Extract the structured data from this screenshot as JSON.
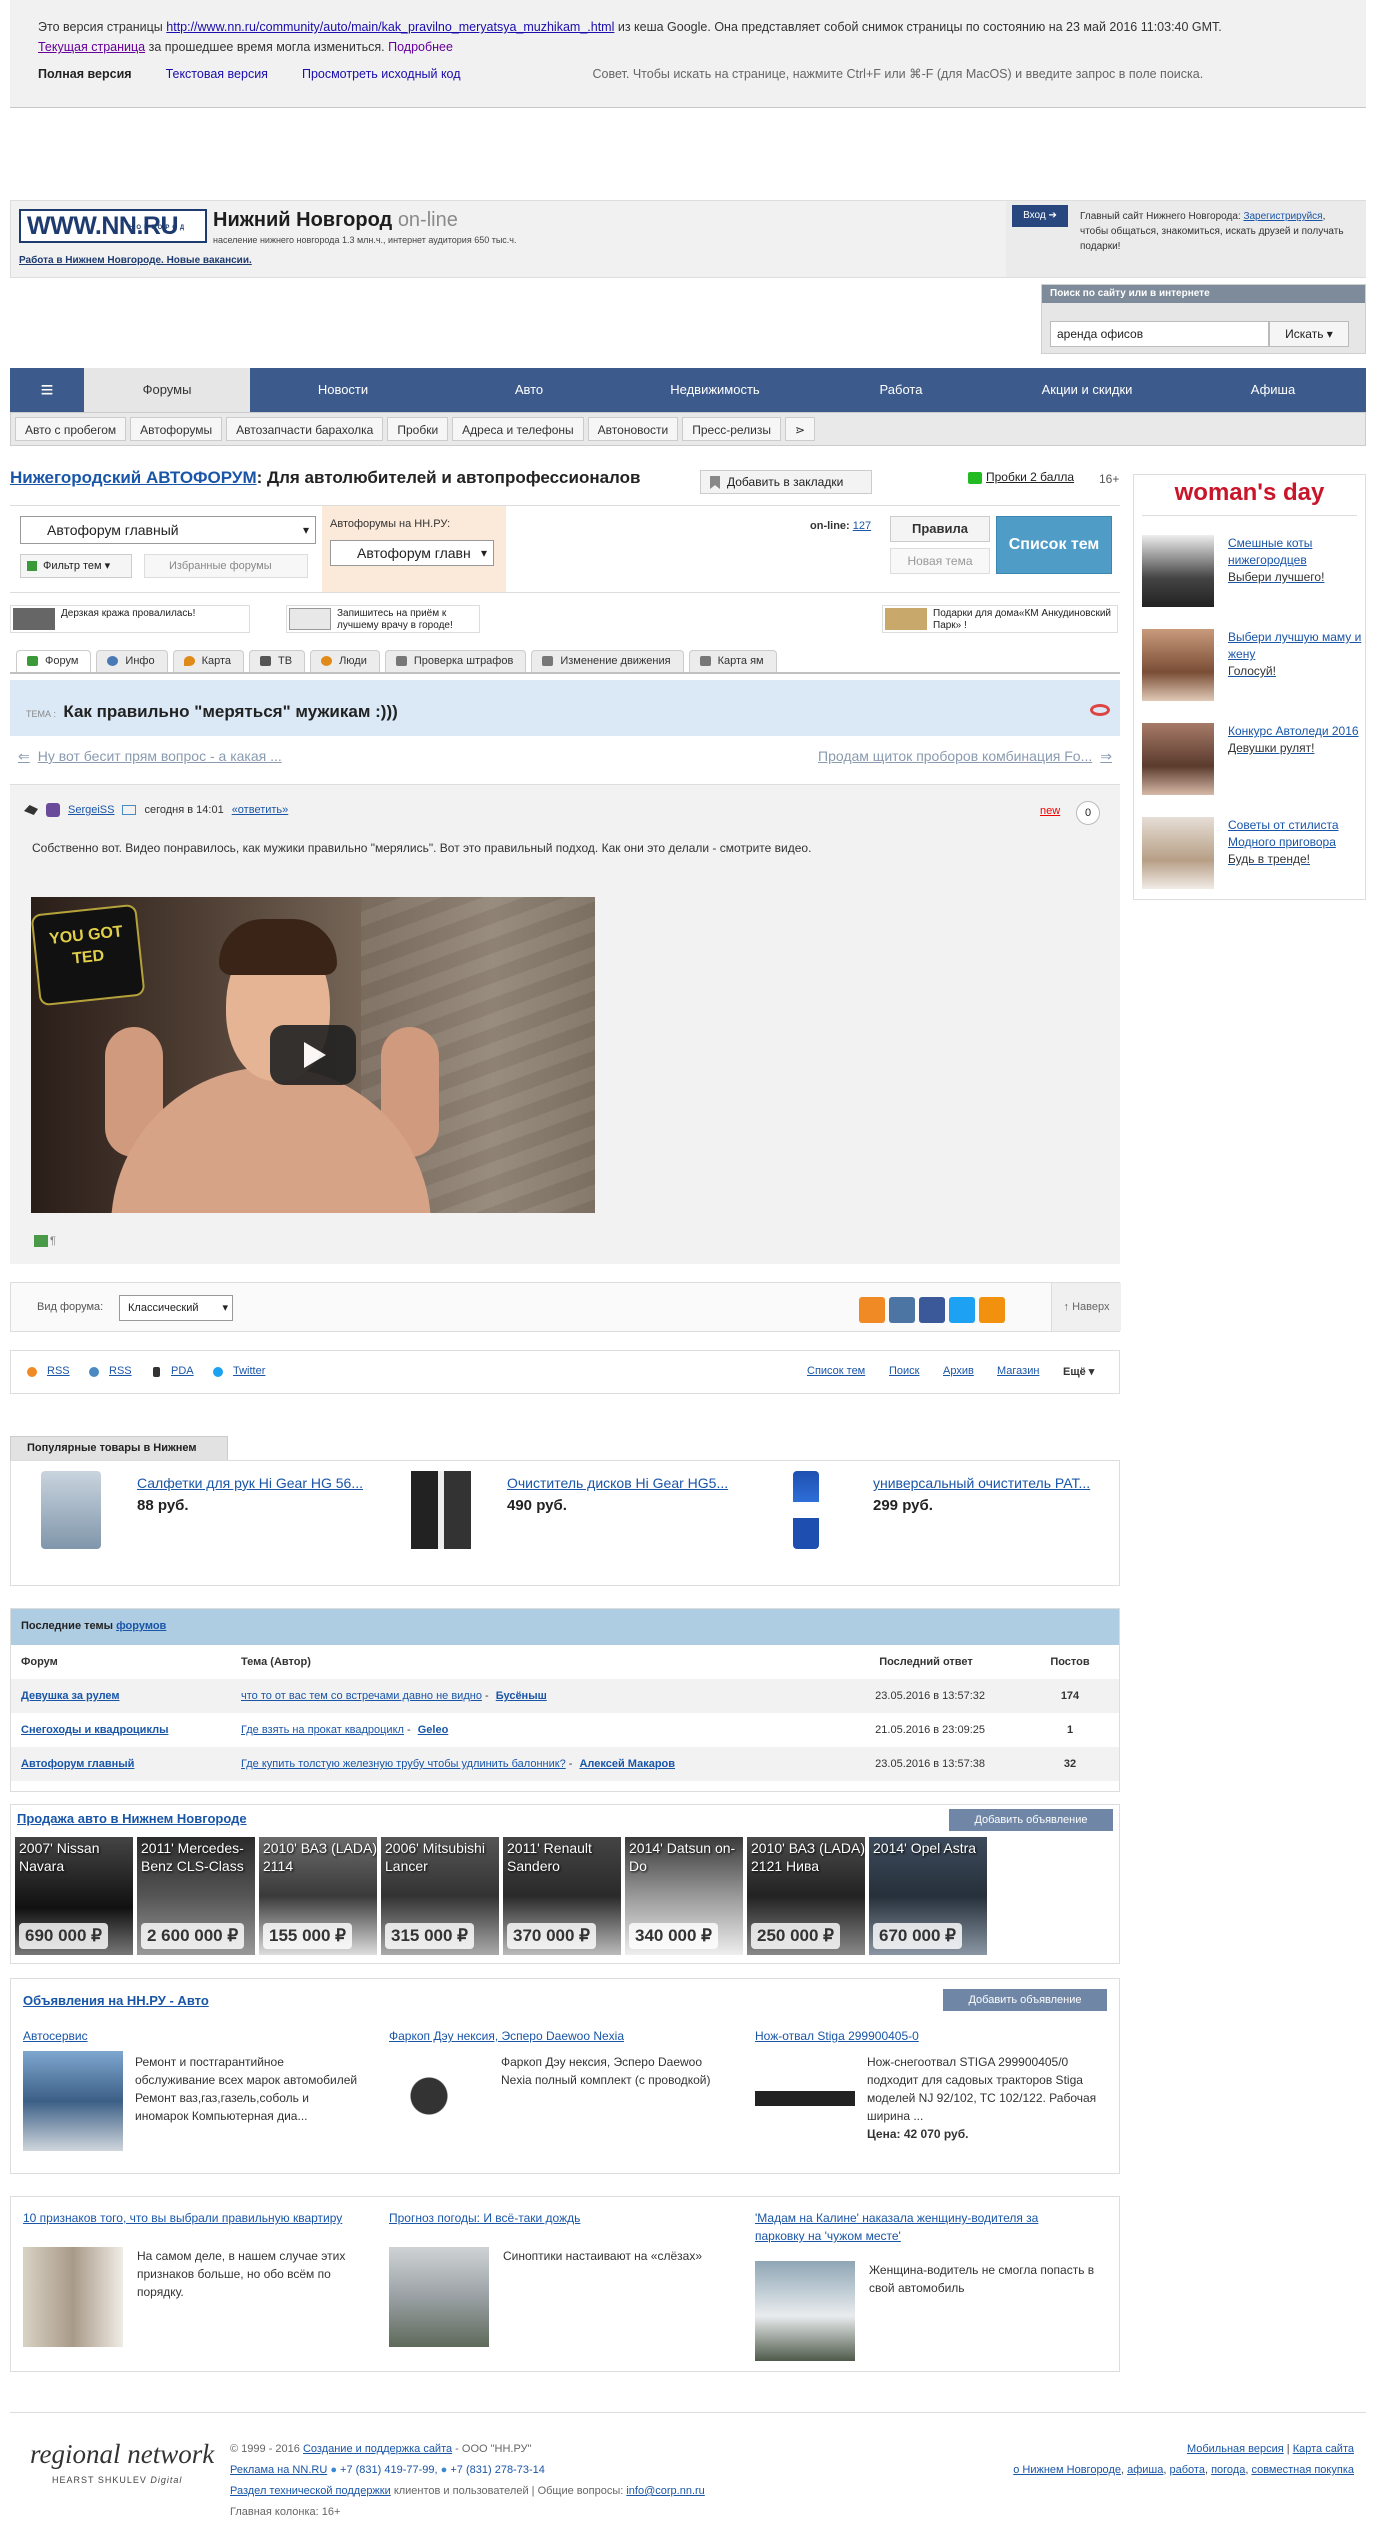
{
  "cache": {
    "line1_prefix": "Это версия страницы",
    "url": "http://www.nn.ru/community/auto/main/kak_pravilno_meryatsya_muzhikam_.html",
    "line1_suffix": "из кеша Google. Она представляет собой снимок страницы по состоянию на 23 май 2016 11:03:40 GMT.",
    "current_link": "Текущая страница",
    "line2_mid": "за прошедшее время могла измениться.",
    "more_link": "Подробнее",
    "full_version": "Полная версия",
    "text_version": "Текстовая версия",
    "source_link": "Просмотреть исходный код",
    "tip": "Совет. Чтобы искать на странице, нажмите Ctrl+F или ⌘-F (для MacOS) и введите запрос в поле поиска."
  },
  "header": {
    "logo": "WWW.NN.RU",
    "logo_sub": "НОВГОРОД",
    "city": "Нижний Новгород",
    "online": "on-line",
    "population": "население нижнего новгорода 1.3 млн.ч., интернет аудитория 650 тыс.ч.",
    "jobs_link": "Работа в Нижнем Новгороде. Новые вакансии.",
    "login": "Вход ➔",
    "login_text_1": "Главный сайт Нижнего Новгорода:",
    "register": "Зарегистрируйся",
    "login_text_2": ", чтобы общаться, знакомиться, искать друзей и получать подарки!"
  },
  "search": {
    "title": "Поиск по сайту или в интернете",
    "value": "аренда офисов",
    "button": "Искать ▾"
  },
  "nav": {
    "menu_icon": "≡",
    "items": [
      "Форумы",
      "Новости",
      "Авто",
      "Недвижимость",
      "Работа",
      "Акции и скидки",
      "Афиша"
    ]
  },
  "subnav": {
    "items": [
      "Авто с пробегом",
      "Автофорумы",
      "Автозапчасти барахолка",
      "Пробки",
      "Адреса и телефоны",
      "Автоновости",
      "Пресс-релизы",
      "⋗"
    ]
  },
  "forum": {
    "title_link": "Нижегородский АВТОФОРУМ",
    "title_rest": ": Для автолюбителей и автопрофессионалов",
    "bookmark": "Добавить в закладки",
    "probki": "Пробки 2 балла",
    "age": "16+",
    "select": "Автофорум главный",
    "filter": "Фильтр тем ▾",
    "favorites": "Избранные форумы",
    "nn_forums_label": "Автофорумы на НН.РУ:",
    "nn_forums_select": "Автофорум главн",
    "online_label": "on-line:",
    "online_count": "127",
    "rules": "Правила",
    "new_topic": "Новая тема",
    "topics_list": "Список тем"
  },
  "promos": [
    "Дерзкая кража провалилась!",
    "Запишитесь на приём к лучшему врачу в городе!",
    "Подарки для дома«КМ Анкудиновский Парк» !"
  ],
  "tabs": [
    "Форум",
    "Инфо",
    "Карта",
    "ТВ",
    "Люди",
    "Проверка штрафов",
    "Изменение движения",
    "Карта ям"
  ],
  "topic": {
    "label": "ТЕМА :",
    "title": "Как правильно \"меряться\" мужикам :)))",
    "prev": "Ну вот бесит прям вопрос - а какая ...",
    "next": "Продам щиток проборов комбинация Fo...",
    "prev_arrow": "⇐",
    "next_arrow": "⇒"
  },
  "post": {
    "author": "SergeiSS",
    "date": "сегодня в 14:01",
    "reply": "«ответить»",
    "new": "new",
    "rating": "0",
    "text": "Собственно вот. Видео понравилось, как мужики правильно \"мерялись\". Вот это правильный подход. Как они это делали - смотрите видео.",
    "video_logo": "YOU GOT TED",
    "pilcrow": "¶"
  },
  "view": {
    "label": "Вид форума:",
    "select": "Классический",
    "totop": "↑ Наверх"
  },
  "links": {
    "left": [
      "RSS",
      "RSS",
      "PDA",
      "Twitter"
    ],
    "right": [
      "Список тем",
      "Поиск",
      "Архив",
      "Магазин"
    ],
    "more": "Ещё ▾"
  },
  "popular": {
    "tab": "Популярные товары в Нижнем",
    "items": [
      {
        "name": "Салфетки для рук Hi Gear HG 56...",
        "price": "88 руб."
      },
      {
        "name": "Очиститель дисков Hi Gear HG5...",
        "price": "490 руб."
      },
      {
        "name": "универсальный очиститель PAT...",
        "price": "299 руб."
      }
    ]
  },
  "last_topics": {
    "title_prefix": "Последние темы",
    "title_link": "форумов",
    "columns": [
      "Форум",
      "Тема (Автор)",
      "Последний ответ",
      "Постов"
    ],
    "rows": [
      {
        "forum": "Девушка за рулем",
        "topic": "что то от вас тем со встречами давно не видно",
        "author": "Бусёныш",
        "last": "23.05.2016 в 13:57:32",
        "posts": "174"
      },
      {
        "forum": "Снегоходы и квадроциклы",
        "topic": "Где взять на прокат квадроцикл",
        "author": "Geleo",
        "last": "21.05.2016 в 23:09:25",
        "posts": "1"
      },
      {
        "forum": "Автофорум главный",
        "topic": "Где купить толстую железную трубу чтобы удлинить балонник?",
        "author": "Алексей Макаров",
        "last": "23.05.2016 в 13:57:38",
        "posts": "32"
      }
    ]
  },
  "autosale": {
    "title": "Продажа авто в Нижнем Новгороде",
    "add": "Добавить объявление",
    "cars": [
      {
        "name": "2007' Nissan Navara",
        "price": "690 000 ₽"
      },
      {
        "name": "2011' Mercedes-Benz CLS-Class",
        "price": "2 600 000 ₽"
      },
      {
        "name": "2010' ВАЗ (LADA) 2114",
        "price": "155 000 ₽"
      },
      {
        "name": "2006' Mitsubishi Lancer",
        "price": "315 000 ₽"
      },
      {
        "name": "2011' Renault Sandero",
        "price": "370 000 ₽"
      },
      {
        "name": "2014' Datsun on-Do",
        "price": "340 000 ₽"
      },
      {
        "name": "2010' ВАЗ (LADA) 2121 Нива",
        "price": "250 000 ₽"
      },
      {
        "name": "2014' Opel Astra",
        "price": "670 000 ₽"
      }
    ]
  },
  "ads": {
    "title": "Объявления на НН.РУ - Авто",
    "add": "Добавить объявление",
    "items": [
      {
        "title": "Автосервис",
        "text": "Ремонт и постгарантийное обслуживание всех марок автомобилей Ремонт ваз,газ,газель,соболь и иномарок Компьютерная диа...",
        "price": ""
      },
      {
        "title": "Фаркоп Дэу нексия, Эсперо Daewoo Nexia",
        "text": "Фаркоп Дэу нексия, Эсперо Daewoo Nexia полный комплект (с проводкой)",
        "price": ""
      },
      {
        "title": "Нож-отвал Stiga 299900405-0",
        "text": "Нож-снегоотвал STIGA 299900405/0 подходит для садовых тракторов Stiga моделей NJ 92/102, TC 102/122. Рабочая ширина ...",
        "price": "Цена: 42 070 руб."
      }
    ]
  },
  "news": [
    {
      "title": "10 признаков того, что вы выбрали правильную квартиру",
      "text": "На самом деле, в нашем случае этих признаков больше, но обо всём по порядку."
    },
    {
      "title": "Прогноз погоды: И всё-таки дождь",
      "text": "Синоптики настаивают на «слёзах»"
    },
    {
      "title": "'Мадам на Калине' наказала женщину-водителя за парковку на 'чужом месте'",
      "text": "Женщина-водитель не смогла попасть в свой автомобиль"
    }
  ],
  "sidebar": {
    "brand": "woman's day",
    "items": [
      {
        "title": "Смешные коты нижегородцев",
        "desc": "Выбери лучшего!"
      },
      {
        "title": "Выбери лучшую маму и жену",
        "desc": "Голосуй!"
      },
      {
        "title": "Конкурс Автоледи 2016",
        "desc": "Девушки рулят!"
      },
      {
        "title": "Советы от стилиста Модного приговора",
        "desc": "Будь в тренде!"
      }
    ]
  },
  "footer": {
    "brand": "regional network",
    "brand_sub_bold": "HEARST SHKULEV",
    "brand_sub_italic": "Digital",
    "copyright": "© 1999 - 2016",
    "creation": "Создание и поддержка сайта",
    "company": "- ООО \"НН.РУ\"",
    "ads_link": "Реклама на NN.RU",
    "phone1": "+7 (831) 419-77-99,",
    "phone2": "+7 (831) 278-73-14",
    "support": "Раздел технической поддержки",
    "support_rest": "клиентов и пользователей | Общие вопросы:",
    "email": "info@corp.nn.ru",
    "main_col": "Главная колонка: 16+",
    "mobile": "Мобильная версия",
    "sitemap": "Карта сайта",
    "bottom_links": [
      "о Нижнем Новгороде",
      "афиша",
      "работа",
      "погода",
      "совместная покупка"
    ]
  },
  "colors": {
    "nav": "#3c5a8b",
    "link": "#1a56a8",
    "topic_bg": "#dbe9f6",
    "topics_btn": "#4f9cc7",
    "last_topics_hd": "#aecde3"
  }
}
